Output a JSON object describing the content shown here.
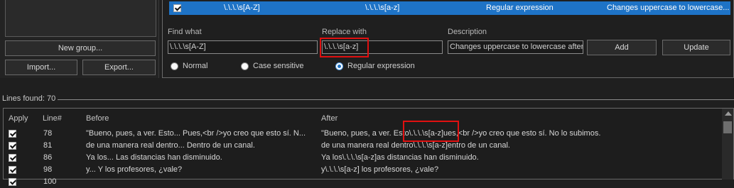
{
  "groups": {
    "new_group_label": "New group...",
    "import_label": "Import...",
    "export_label": "Export..."
  },
  "rule": {
    "find": "\\.\\.\\.\\s[A-Z]",
    "replace": "\\.\\.\\.\\s[a-z]",
    "type": "Regular expression",
    "description": "Changes uppercase to lowercase..."
  },
  "form": {
    "find_label": "Find what",
    "replace_label": "Replace with",
    "description_label": "Description",
    "find_value": "\\.\\.\\.\\s[A-Z]",
    "replace_value": "\\.\\.\\.\\s[a-z]",
    "description_value": "Changes uppercase to lowercase after",
    "add_label": "Add",
    "update_label": "Update",
    "mode_normal": "Normal",
    "mode_case": "Case sensitive",
    "mode_regex": "Regular expression"
  },
  "results": {
    "lines_found": "Lines found: 70",
    "headers": {
      "apply": "Apply",
      "line": "Line#",
      "before": "Before",
      "after": "After"
    },
    "rows": [
      {
        "line": "78",
        "before": "\"Bueno, pues, a ver. Esto... Pues,<br />yo creo que esto sí. N...",
        "after": "\"Bueno, pues, a ver. Esto\\.\\.\\.\\s[a-z]ues,<br />yo creo que esto sí. No lo subimos."
      },
      {
        "line": "81",
        "before": "de una manera real dentro... Dentro de un canal.",
        "after": "de una manera real dentro\\.\\.\\.\\s[a-z]entro de un canal."
      },
      {
        "line": "86",
        "before": "Ya los... Las distancias han disminuido.",
        "after": "Ya los\\.\\.\\.\\s[a-z]as distancias han disminuido."
      },
      {
        "line": "98",
        "before": "y... Y los profesores, ¿vale?",
        "after": "y\\.\\.\\.\\s[a-z] los profesores, ¿vale?"
      },
      {
        "line": "100",
        "before": "",
        "after": ""
      }
    ]
  },
  "colors": {
    "selection": "#1e73c6",
    "highlight_box": "#e01010"
  }
}
